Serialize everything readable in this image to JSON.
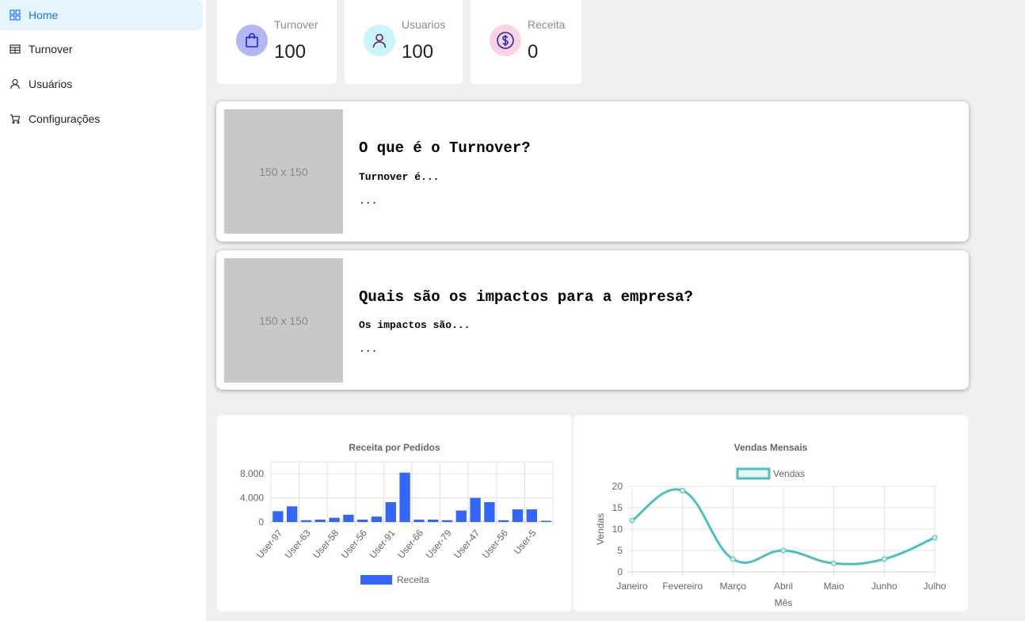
{
  "sidebar": {
    "items": [
      {
        "label": "Home",
        "icon": "dashboard-icon",
        "active": true
      },
      {
        "label": "Turnover",
        "icon": "table-icon",
        "active": false
      },
      {
        "label": "Usuários",
        "icon": "user-icon",
        "active": false
      },
      {
        "label": "Configurações",
        "icon": "cart-icon",
        "active": false
      }
    ]
  },
  "stats": [
    {
      "label": "Turnover",
      "value": "100",
      "icon": "shopping-bag-icon",
      "bg": "#b3b7f5",
      "fg": "#1d23c9"
    },
    {
      "label": "Usuarios",
      "value": "100",
      "icon": "user-icon",
      "bg": "#c8f6fa",
      "fg": "#6b1a6b"
    },
    {
      "label": "Receita",
      "value": "0",
      "icon": "dollar-icon",
      "bg": "#fbd3da",
      "fg": "#2323d6"
    }
  ],
  "cards": [
    {
      "image_text": "150 x 150",
      "title": "O que é o Turnover?",
      "subtitle": "Turnover é...",
      "body": "..."
    },
    {
      "image_text": "150 x 150",
      "title": "Quais são os impactos para a empresa?",
      "subtitle": "Os impactos são...",
      "body": "..."
    }
  ],
  "colors": {
    "accent": "#1677ff",
    "bar": "#3366ff",
    "line": "#4bc0c0"
  },
  "chart_data": [
    {
      "type": "bar",
      "title": "Receita por Pedidos",
      "categories": [
        "User-97",
        "",
        "User-63",
        "",
        "User-58",
        "",
        "User-56",
        "",
        "User-91",
        "",
        "User-66",
        "",
        "User-79",
        "",
        "User-47",
        "",
        "User-56",
        "",
        "User-5",
        ""
      ],
      "tick_labels": [
        "User-97",
        "User-63",
        "User-58",
        "User-56",
        "User-91",
        "User-66",
        "User-79",
        "User-47",
        "User-56",
        "User-5"
      ],
      "series": [
        {
          "name": "Receita",
          "values": [
            1800,
            2600,
            300,
            400,
            700,
            1200,
            400,
            900,
            3300,
            8200,
            400,
            400,
            300,
            1900,
            4000,
            3300,
            300,
            2100,
            2100,
            200
          ]
        }
      ],
      "ylim": [
        0,
        10000
      ],
      "yticks": [
        "0",
        "4.000",
        "8.000"
      ],
      "ytick_values": [
        0,
        4000,
        8000
      ],
      "legend": "bottom",
      "grid": true
    },
    {
      "type": "line",
      "title": "Vendas Mensais",
      "categories": [
        "Janeiro",
        "Fevereiro",
        "Março",
        "Abril",
        "Maio",
        "Junho",
        "Julho"
      ],
      "series": [
        {
          "name": "Vendas",
          "values": [
            12,
            19,
            3,
            5,
            2,
            3,
            8
          ]
        }
      ],
      "xlabel": "Mês",
      "ylabel": "Vendas",
      "ylim": [
        0,
        20
      ],
      "yticks": [
        "0",
        "5",
        "10",
        "15",
        "20"
      ],
      "legend": "top",
      "grid": true
    }
  ]
}
